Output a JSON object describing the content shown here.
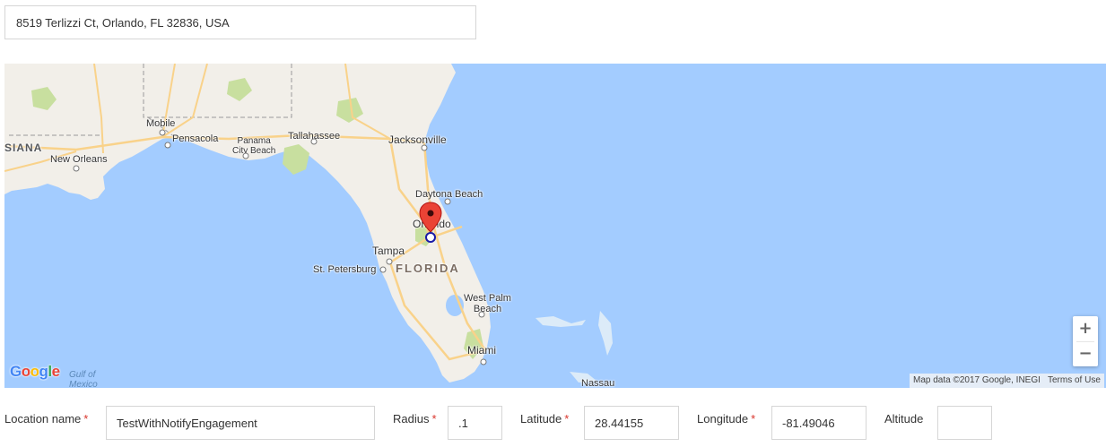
{
  "address": {
    "value": "8519 Terlizzi Ct, Orlando, FL 32836, USA"
  },
  "map": {
    "labels": {
      "mobile": "Mobile",
      "pensacola": "Pensacola",
      "panama_city": "Panama\nCity Beach",
      "tallahassee": "Tallahassee",
      "jacksonville": "Jacksonville",
      "louisiana_cut": "SIANA",
      "new_orleans": "New Orleans",
      "daytona": "Daytona Beach",
      "orlando": "Orlando",
      "tampa": "Tampa",
      "st_petersburg": "St. Petersburg",
      "florida": "FLORIDA",
      "west_palm": "West Palm\nBeach",
      "miami": "Miami",
      "gulf": "Gulf of\nMexico",
      "nassau": "Nassau"
    },
    "google_logo": "Google",
    "attribution": "Map data ©2017 Google, INEGI",
    "terms": "Terms of Use",
    "zoom_in": "+",
    "zoom_out": "−",
    "colors": {
      "water": "#a3ccff",
      "land": "#f2efe9",
      "park": "#c8df9f",
      "road": "#f9d28a",
      "marker": "#ea4335"
    }
  },
  "form": {
    "location_name": {
      "label": "Location name",
      "required": "*",
      "value": "TestWithNotifyEngagement"
    },
    "radius": {
      "label": "Radius",
      "required": "*",
      "value": ".1"
    },
    "latitude": {
      "label": "Latitude",
      "required": "*",
      "value": "28.44155"
    },
    "longitude": {
      "label": "Longitude",
      "required": "*",
      "value": "-81.49046"
    },
    "altitude": {
      "label": "Altitude",
      "value": ""
    }
  }
}
